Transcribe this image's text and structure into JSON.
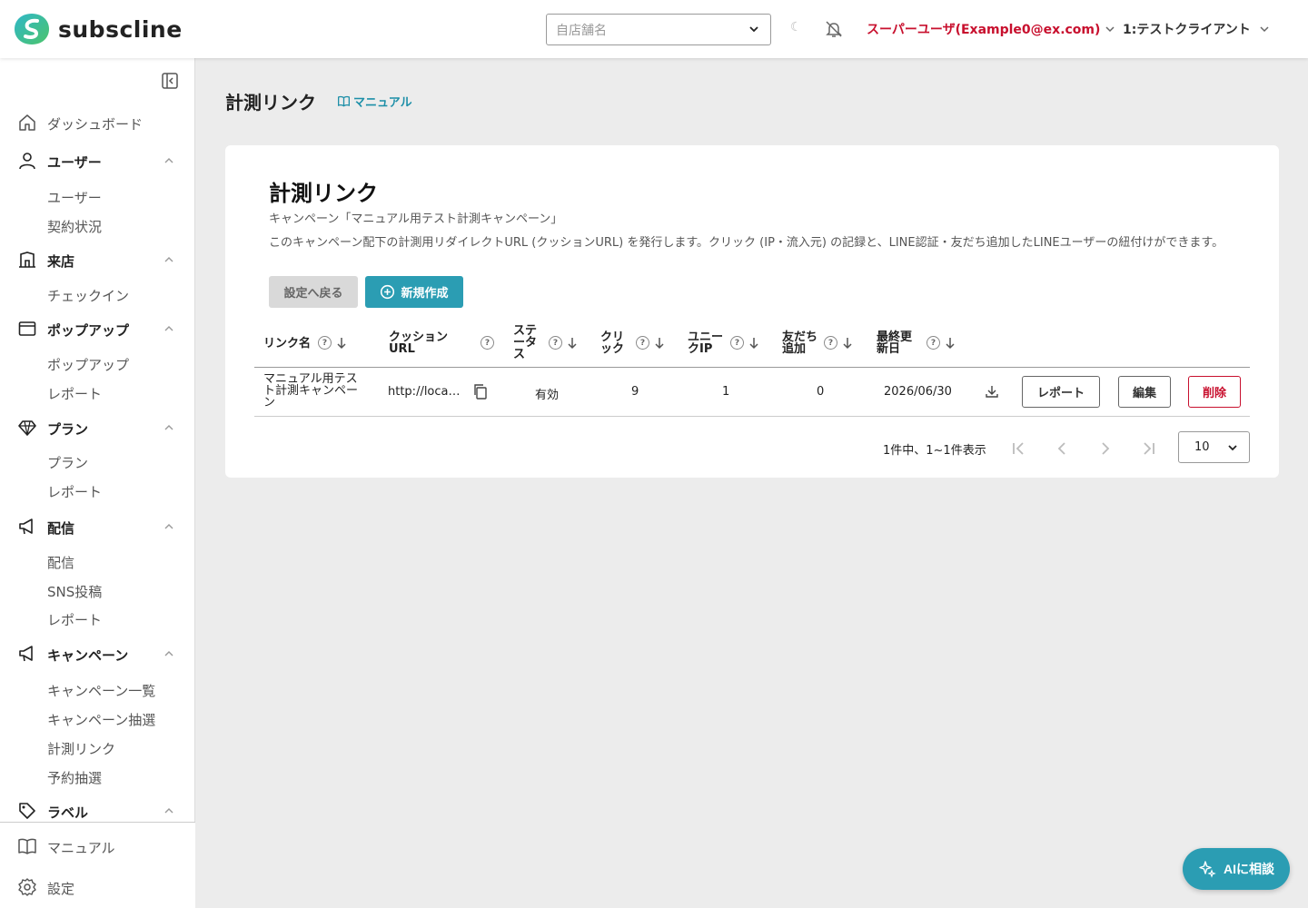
{
  "header": {
    "logo_text": "subscline",
    "store_placeholder": "自店舗名",
    "moon_glyph": "☾",
    "user_label": "スーパーユーザ(Example0@ex.com)",
    "client_label": "1:テストクライアント"
  },
  "sidebar": {
    "dashboard": "ダッシュボード",
    "groups": {
      "user": {
        "label": "ユーザー",
        "items": [
          "ユーザー",
          "契約状況"
        ]
      },
      "visit": {
        "label": "来店",
        "items": [
          "チェックイン"
        ]
      },
      "popup": {
        "label": "ポップアップ",
        "items": [
          "ポップアップ",
          "レポート"
        ]
      },
      "plan": {
        "label": "プラン",
        "items": [
          "プラン",
          "レポート"
        ]
      },
      "delivery": {
        "label": "配信",
        "items": [
          "配信",
          "SNS投稿",
          "レポート"
        ]
      },
      "campaign": {
        "label": "キャンペーン",
        "items": [
          "キャンペーン一覧",
          "キャンペーン抽選",
          "計測リンク",
          "予約抽選"
        ]
      },
      "label": {
        "label": "ラベル"
      }
    },
    "footer": {
      "manual": "マニュアル",
      "settings": "設定"
    }
  },
  "main": {
    "page_title": "計測リンク",
    "manual_link": "マニュアル",
    "card": {
      "title": "計測リンク",
      "subtitle": "キャンペーン「マニュアル用テスト計測キャンペーン」",
      "description": "このキャンペーン配下の計測用リダイレクトURL (クッションURL) を発行します。クリック (IP・流入元) の記録と、LINE認証・友だち追加したLINEユーザーの紐付けができます。",
      "back_button": "設定へ戻る",
      "new_button": "新規作成"
    },
    "table": {
      "headers": {
        "name": "リンク名",
        "url_1": "クッション",
        "url_2": "URL",
        "status_1": "ステ",
        "status_2": "ータ",
        "status_3": "ス",
        "click_1": "クリ",
        "click_2": "ック",
        "unique_1": "ユニー",
        "unique_2": "クIP",
        "friend_1": "友だち",
        "friend_2": "追加",
        "updated_1": "最終更",
        "updated_2": "新日"
      },
      "rows": [
        {
          "name_1": "マニュアル用テス",
          "name_2": "ト計測キャンペー",
          "name_3": "ン",
          "url": "http://loca…",
          "status": "有効",
          "clicks": "9",
          "unique_ip": "1",
          "friends": "0",
          "updated": "2026/06/30",
          "report_button": "レポート",
          "edit_button": "編集",
          "delete_button": "削除"
        }
      ]
    },
    "pagination": {
      "summary": "1件中、1~1件表示",
      "per_page": "10"
    }
  },
  "ai_button": "AIに相談",
  "colors": {
    "accent": "#2b9db3",
    "danger": "#c8102e",
    "link": "#1d8fa8"
  }
}
